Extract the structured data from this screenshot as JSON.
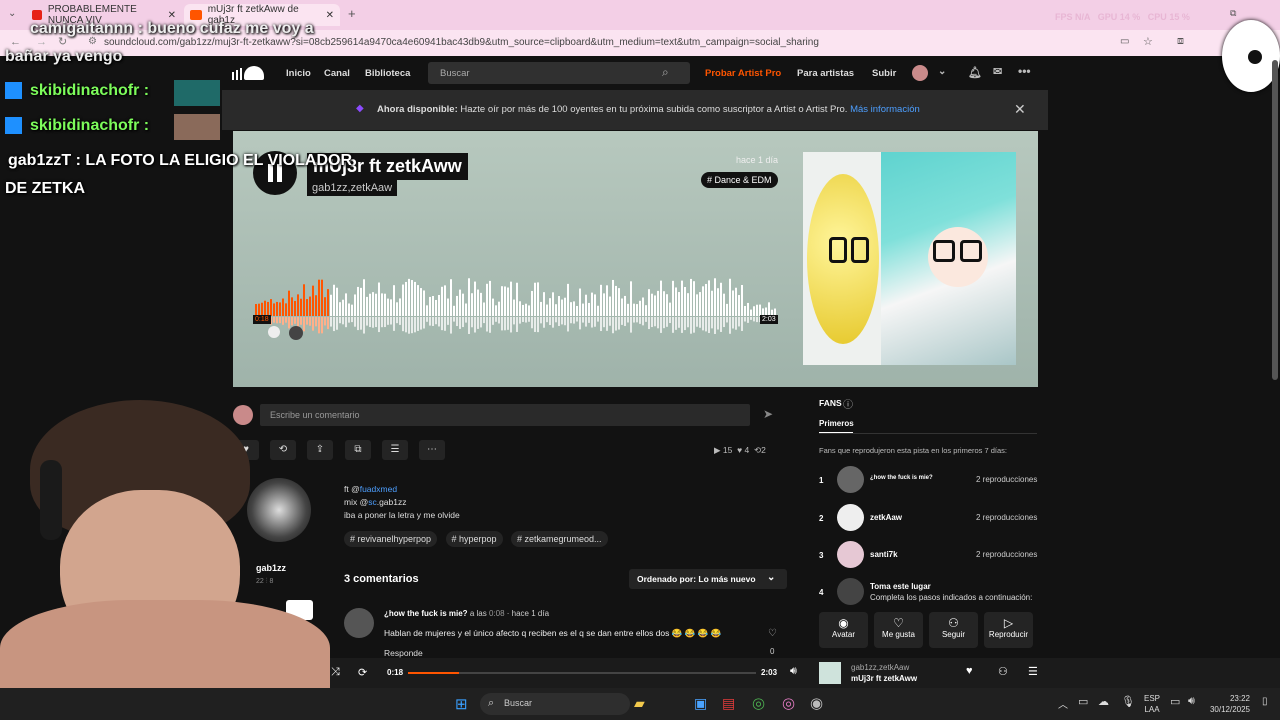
{
  "browser": {
    "tab1_title": "PROBABLEMENTE NUNCA VIV",
    "tab2_title": "mUj3r ft zetkAww de gab1z",
    "url": "soundcloud.com/gab1zz/muj3r-ft-zetkaww?si=08cb259614a9470ca4e60941bac43db9&utm_source=clipboard&utm_medium=text&utm_campaign=social_sharing",
    "fps": "FPS",
    "na": "N/A",
    "gpu1": "GPU",
    "gpu1_val": "14 %",
    "cpu": "CPU",
    "cpu_val": "15 %"
  },
  "chat": {
    "line1": "camigaitannn : bueno cufaz me voy a",
    "line1b": "bañar ya vengo",
    "user2": "skibidinachofr :",
    "user3": "skibidinachofr :",
    "line4": "gab1zzT : LA FOTO LA ELIGIO EL VIOLADOR",
    "line4b": "DE ZETKA"
  },
  "header": {
    "inicio": "Inicio",
    "canal": "Canal",
    "biblioteca": "Biblioteca",
    "search_placeholder": "Buscar",
    "probar": "Probar Artist Pro",
    "para_artistas": "Para artistas",
    "subir": "Subir"
  },
  "banner": {
    "bold": "Ahora disponible:",
    "text": "Hazte oír por más de 100 oyentes en tu próxima subida como suscriptor a Artist o Artist Pro.",
    "link": "Más información"
  },
  "track": {
    "title": "mUj3r ft zetkAww",
    "artist": "gab1zz,zetkAaw",
    "time_ago": "hace 1 día",
    "genre": "# Dance & EDM",
    "elapsed": "0:18",
    "duration": "2:03",
    "progress": 0.146
  },
  "comment_box": {
    "placeholder": "Escribe un comentario"
  },
  "stats": {
    "plays": "15",
    "likes": "4",
    "reposts": "2"
  },
  "description": {
    "line1_prefix": "ft @",
    "line1_link": "fuadxmed",
    "line2_prefix": "mix @",
    "line2_link": "sc",
    "line2_suffix": ".gab1zz",
    "line3": "iba a poner la letra y me olvide",
    "tags": [
      "# revivanelhyperpop",
      "# hyperpop",
      "# zetkamegrumeod..."
    ]
  },
  "uploader": {
    "name": "gab1zz",
    "followers": "22",
    "tracks": "8"
  },
  "comments": {
    "count_label": "3 comentarios",
    "sort_label": "Ordenado por: Lo más nuevo",
    "first_user": "¿how the fuck is mie?",
    "first_at": "a las",
    "first_time": "0:08",
    "first_ago": "· hace 1 día",
    "first_text": "Hablan de mujeres y el único afecto q reciben es el q se dan entre ellos dos 😂 😂 😂 😂",
    "reply": "Responde",
    "likes": "0"
  },
  "fans": {
    "title": "FANS",
    "tab": "Primeros",
    "subtitle": "Fans que reprodujeron esta pista en los primeros 7 días:",
    "rows": [
      {
        "rank": "1",
        "name": "¿how the fuck is mie?",
        "plays": "2 reproducciones"
      },
      {
        "rank": "2",
        "name": "zetkAaw",
        "plays": "2 reproducciones"
      },
      {
        "rank": "3",
        "name": "santi7k",
        "plays": "2 reproducciones"
      }
    ],
    "row4_rank": "4",
    "row4_title": "Toma este lugar",
    "row4_sub": "Completa los pasos indicados a continuación:",
    "actions": [
      "Avatar",
      "Me gusta",
      "Seguir",
      "Reproducir"
    ]
  },
  "player": {
    "elapsed": "0:18",
    "duration": "2:03",
    "artist": "gab1zz,zetkAaw",
    "title": "mUj3r ft zetkAww",
    "progress": 0.146
  },
  "taskbar": {
    "search": "Buscar",
    "lang1": "ESP",
    "lang2": "LAA",
    "time": "23:22",
    "date": "30/12/2025"
  }
}
